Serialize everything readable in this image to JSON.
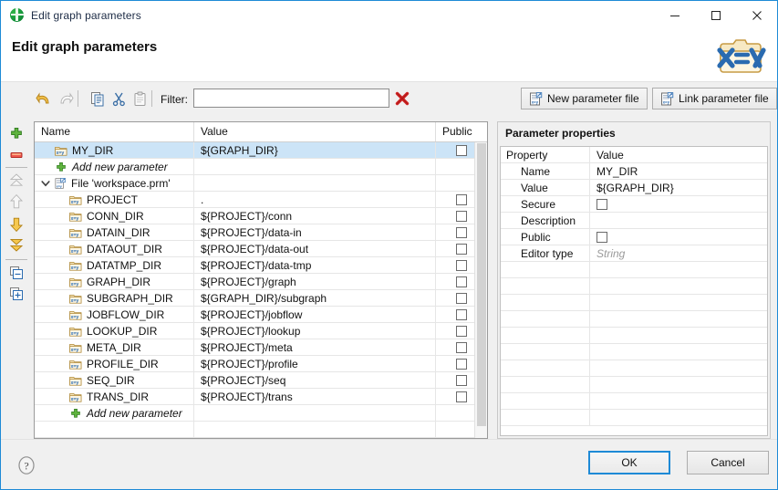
{
  "window": {
    "title": "Edit graph parameters",
    "icon": "clover-app-icon",
    "controls": [
      {
        "name": "minimize-button",
        "glyph": "minimize-icon"
      },
      {
        "name": "maximize-button",
        "glyph": "maximize-icon"
      },
      {
        "name": "close-button",
        "glyph": "close-icon"
      }
    ],
    "accent_color": "#1e8ad6",
    "selection_color": "#cce4f7"
  },
  "heading": {
    "text": "Edit graph parameters",
    "logo_icon": "folder-x-equals-y-logo",
    "logo_text": "X=Y"
  },
  "toolbar": {
    "undo_icon": "undo-arrow-icon",
    "redo_icon": "redo-arrow-icon",
    "copy_icon": "copy-icon",
    "cut_icon": "cut-scissors-icon",
    "paste_icon": "paste-clipboard-icon",
    "filter_label": "Filter:",
    "filter_value": "",
    "filter_placeholder": "",
    "clear_icon": "red-x-clear-icon",
    "new_parameter_file_label": "New parameter file",
    "new_parameter_file_icon": "new-parameter-file-icon",
    "link_parameter_file_label": "Link parameter file",
    "link_parameter_file_icon": "link-parameter-file-icon"
  },
  "left_toolbar": {
    "items": [
      {
        "name": "add-parameter-button",
        "icon": "green-plus-icon",
        "enabled": true
      },
      {
        "name": "remove-parameter-button",
        "icon": "red-minus-icon",
        "enabled": true
      },
      {
        "name": "move-to-top-button",
        "icon": "double-up-arrow-icon",
        "enabled": false
      },
      {
        "name": "move-up-button",
        "icon": "up-arrow-icon",
        "enabled": false
      },
      {
        "name": "move-down-button",
        "icon": "down-arrow-icon",
        "enabled": true
      },
      {
        "name": "move-to-bottom-button",
        "icon": "double-down-arrow-icon",
        "enabled": true
      },
      {
        "name": "collapse-all-button",
        "icon": "collapse-all-icon",
        "enabled": true
      },
      {
        "name": "expand-all-button",
        "icon": "expand-all-icon",
        "enabled": true
      }
    ]
  },
  "table": {
    "columns": [
      "Name",
      "Value",
      "Public"
    ],
    "rows": [
      {
        "kind": "parameter",
        "indent": 1,
        "icon": "parameter-icon",
        "name": "MY_DIR",
        "value": "${GRAPH_DIR}",
        "public": false,
        "selected": true,
        "has_checkbox": true
      },
      {
        "kind": "add",
        "indent": 1,
        "icon": "green-plus-icon",
        "name": "Add new parameter",
        "value": "",
        "has_checkbox": false
      },
      {
        "kind": "file",
        "indent": 0,
        "icon": "parameter-file-icon",
        "chevron": "chevron-down-icon",
        "name": "File 'workspace.prm'",
        "value": "",
        "has_checkbox": false
      },
      {
        "kind": "parameter",
        "indent": 2,
        "icon": "parameter-icon",
        "name": "PROJECT",
        "value": ".",
        "public": false,
        "has_checkbox": true
      },
      {
        "kind": "parameter",
        "indent": 2,
        "icon": "parameter-icon",
        "name": "CONN_DIR",
        "value": "${PROJECT}/conn",
        "public": false,
        "has_checkbox": true
      },
      {
        "kind": "parameter",
        "indent": 2,
        "icon": "parameter-icon",
        "name": "DATAIN_DIR",
        "value": "${PROJECT}/data-in",
        "public": false,
        "has_checkbox": true
      },
      {
        "kind": "parameter",
        "indent": 2,
        "icon": "parameter-icon",
        "name": "DATAOUT_DIR",
        "value": "${PROJECT}/data-out",
        "public": false,
        "has_checkbox": true
      },
      {
        "kind": "parameter",
        "indent": 2,
        "icon": "parameter-icon",
        "name": "DATATMP_DIR",
        "value": "${PROJECT}/data-tmp",
        "public": false,
        "has_checkbox": true
      },
      {
        "kind": "parameter",
        "indent": 2,
        "icon": "parameter-icon",
        "name": "GRAPH_DIR",
        "value": "${PROJECT}/graph",
        "public": false,
        "has_checkbox": true
      },
      {
        "kind": "parameter",
        "indent": 2,
        "icon": "parameter-icon",
        "name": "SUBGRAPH_DIR",
        "value": "${GRAPH_DIR}/subgraph",
        "public": false,
        "has_checkbox": true
      },
      {
        "kind": "parameter",
        "indent": 2,
        "icon": "parameter-icon",
        "name": "JOBFLOW_DIR",
        "value": "${PROJECT}/jobflow",
        "public": false,
        "has_checkbox": true
      },
      {
        "kind": "parameter",
        "indent": 2,
        "icon": "parameter-icon",
        "name": "LOOKUP_DIR",
        "value": "${PROJECT}/lookup",
        "public": false,
        "has_checkbox": true
      },
      {
        "kind": "parameter",
        "indent": 2,
        "icon": "parameter-icon",
        "name": "META_DIR",
        "value": "${PROJECT}/meta",
        "public": false,
        "has_checkbox": true
      },
      {
        "kind": "parameter",
        "indent": 2,
        "icon": "parameter-icon",
        "name": "PROFILE_DIR",
        "value": "${PROJECT}/profile",
        "public": false,
        "has_checkbox": true
      },
      {
        "kind": "parameter",
        "indent": 2,
        "icon": "parameter-icon",
        "name": "SEQ_DIR",
        "value": "${PROJECT}/seq",
        "public": false,
        "has_checkbox": true
      },
      {
        "kind": "parameter",
        "indent": 2,
        "icon": "parameter-icon",
        "name": "TRANS_DIR",
        "value": "${PROJECT}/trans",
        "public": false,
        "has_checkbox": true
      },
      {
        "kind": "add",
        "indent": 2,
        "icon": "green-plus-icon",
        "name": "Add new parameter",
        "value": "",
        "has_checkbox": false
      }
    ]
  },
  "properties_panel": {
    "title": "Parameter properties",
    "header": {
      "key": "Property",
      "value": "Value"
    },
    "rows": [
      {
        "key": "Name",
        "value": "MY_DIR",
        "type": "text"
      },
      {
        "key": "Value",
        "value": "${GRAPH_DIR}",
        "type": "text"
      },
      {
        "key": "Secure",
        "value": "",
        "type": "checkbox",
        "checked": false
      },
      {
        "key": "Description",
        "value": "",
        "type": "text"
      },
      {
        "key": "Public",
        "value": "",
        "type": "checkbox",
        "checked": false
      },
      {
        "key": "Editor type",
        "value": "String",
        "type": "placeholder"
      }
    ]
  },
  "footer": {
    "help_icon": "help-question-icon",
    "ok_label": "OK",
    "cancel_label": "Cancel"
  }
}
